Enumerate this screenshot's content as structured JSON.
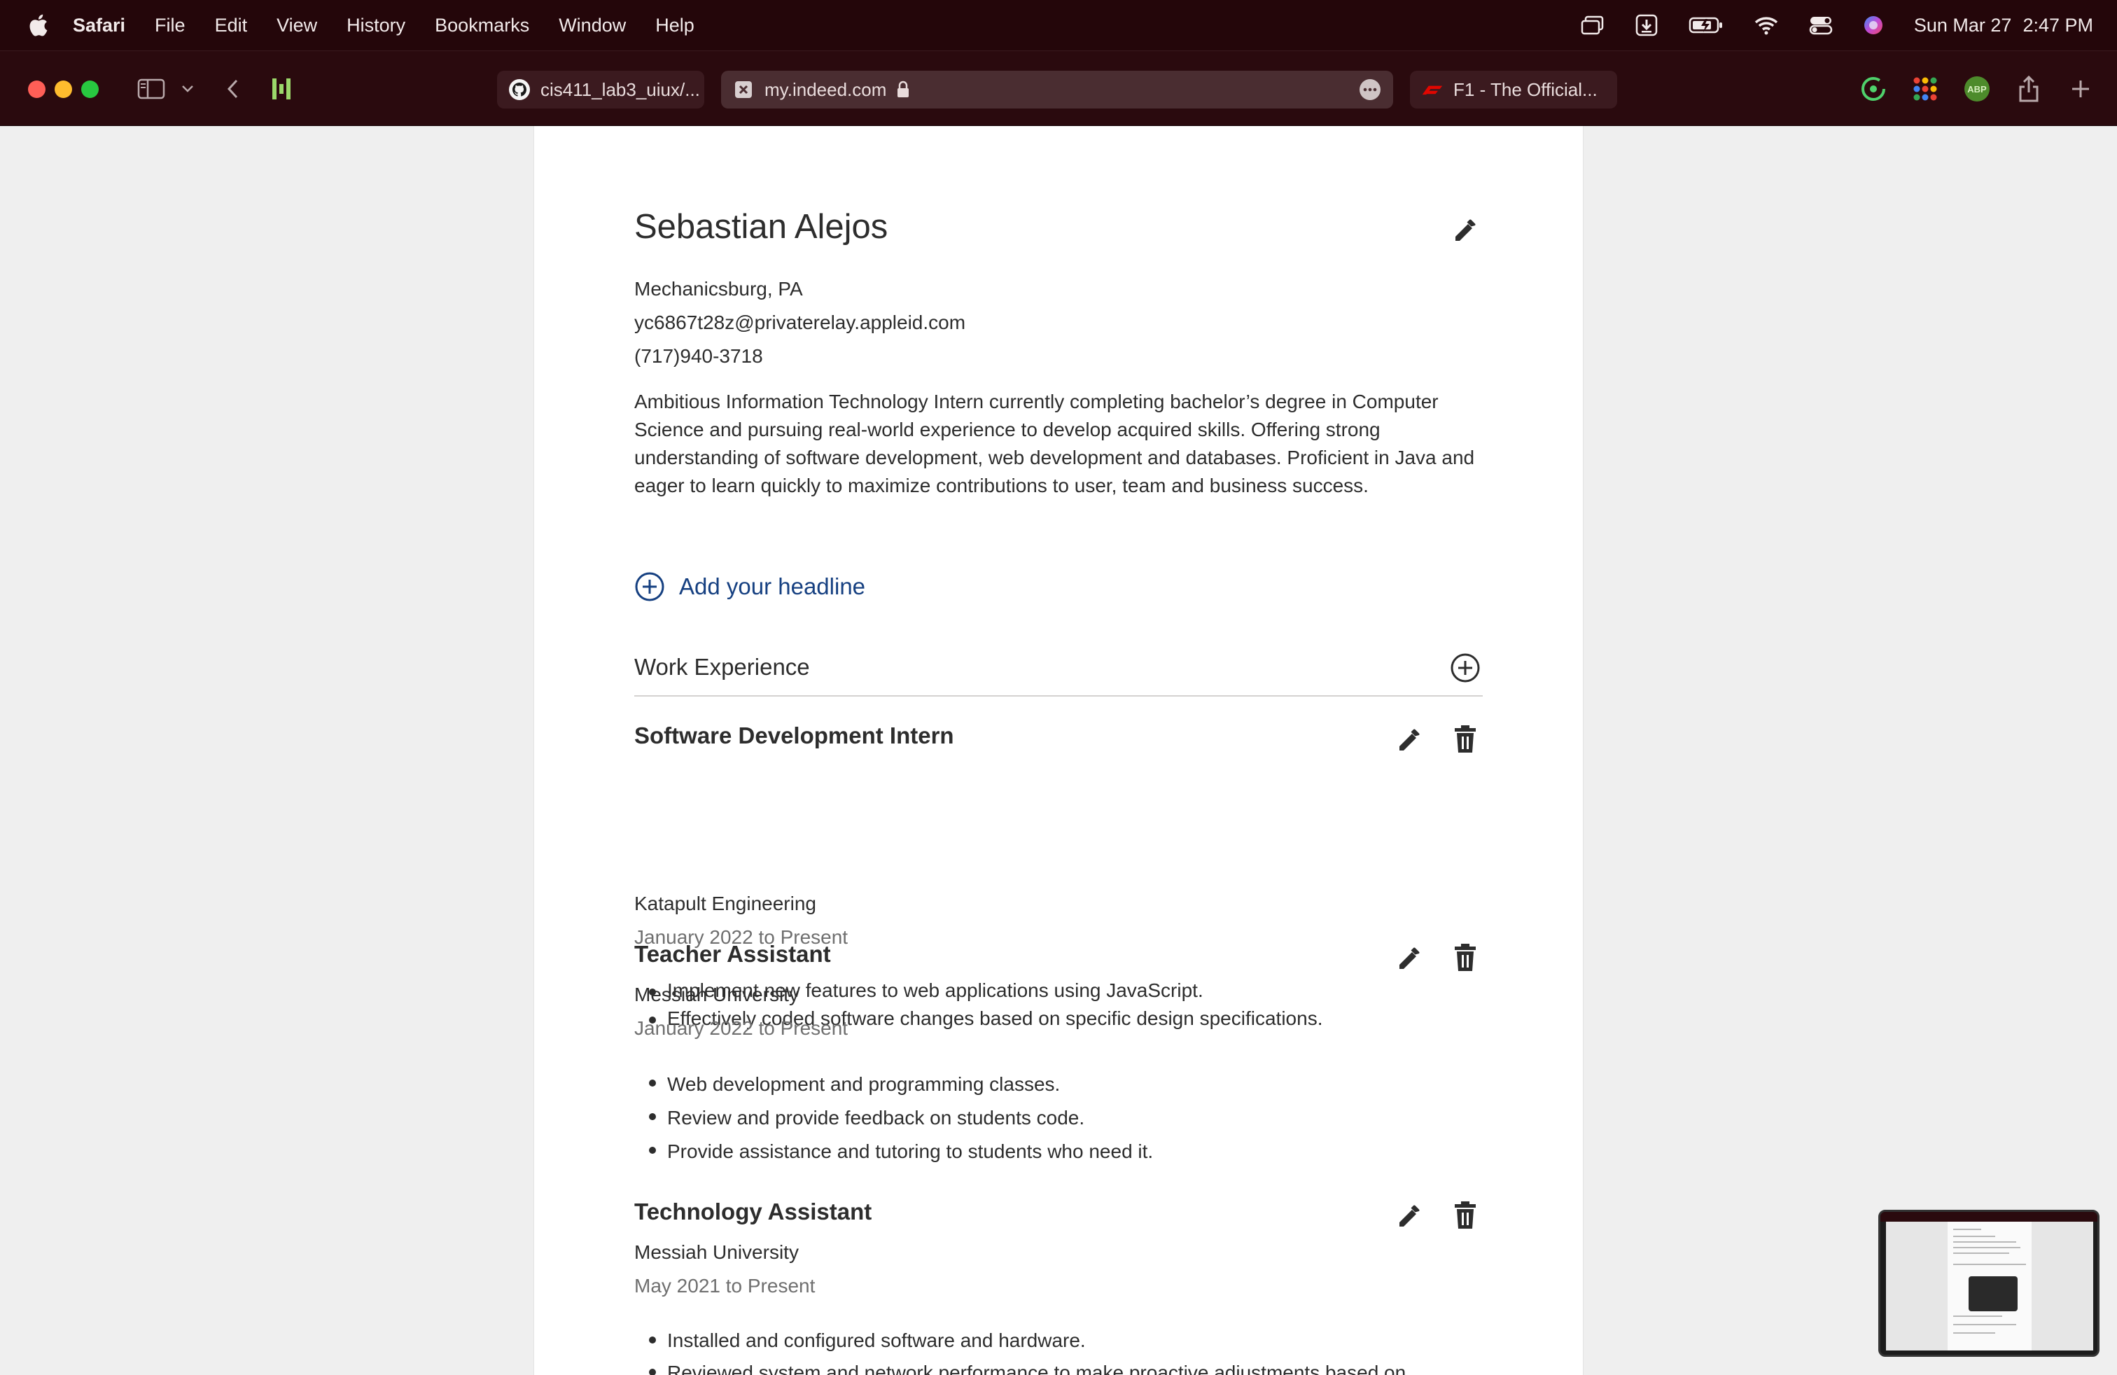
{
  "menubar": {
    "app_name": "Safari",
    "items": [
      "File",
      "Edit",
      "View",
      "History",
      "Bookmarks",
      "Window",
      "Help"
    ],
    "date": "Sun Mar 27",
    "time": "2:47 PM"
  },
  "browser": {
    "tabs": [
      {
        "label": "cis411_lab3_uiux/...",
        "icon": "github-icon"
      },
      {
        "label": "my.indeed.com",
        "icon": "indeed-icon"
      },
      {
        "label": "F1 - The Official...",
        "icon": "f1-icon"
      }
    ],
    "extension_badge": "ABP"
  },
  "resume": {
    "name": "Sebastian Alejos",
    "location": "Mechanicsburg, PA",
    "email": "yc6867t28z@privaterelay.appleid.com",
    "phone": "(717)940-3718",
    "summary": "Ambitious Information Technology Intern currently completing bachelor’s degree in Computer Science and pursuing real-world experience to develop acquired skills. Offering strong understanding of software development, web development and databases. Proficient in Java and eager to learn quickly to maximize contributions to user, team and business success.",
    "add_headline_label": "Add your headline",
    "work_experience_title": "Work Experience",
    "jobs": [
      {
        "title": "Software Development Intern",
        "company": "Katapult Engineering",
        "dates": "January 2022 to Present",
        "bullets": [
          "Implement new features to web applications using JavaScript.",
          "Effectively coded software changes based on specific design specifications."
        ]
      },
      {
        "title": "Teacher Assistant",
        "company": "Messiah University",
        "dates": "January 2022 to Present",
        "bullets": [
          "Web development and programming classes.",
          "Review and provide feedback on students code.",
          "Provide assistance and tutoring to students who need it."
        ]
      },
      {
        "title": "Technology Assistant",
        "company": "Messiah University",
        "dates": "May 2021 to Present",
        "bullets": [
          "Installed and configured software and hardware.",
          "Reviewed system and network performance to make proactive adjustments based on"
        ]
      }
    ]
  },
  "colors": {
    "menubar_bg": "#24060a",
    "toolbar_bg": "#2a0a0e",
    "link_blue": "#164081",
    "text": "#2d2d2d",
    "muted": "#6f6f6f"
  }
}
